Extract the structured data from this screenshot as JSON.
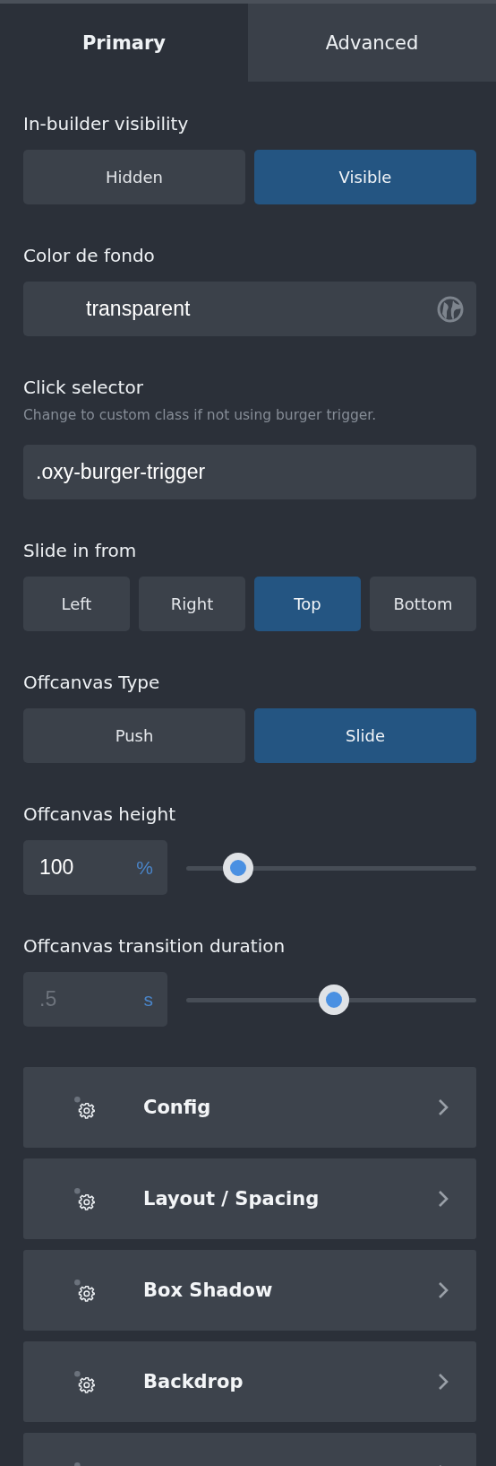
{
  "tabs": [
    {
      "label": "Primary",
      "selected": true
    },
    {
      "label": "Advanced",
      "selected": false
    }
  ],
  "controls": [
    {
      "kind": "toggle",
      "label": "In-builder visibility",
      "options": [
        {
          "label": "Hidden",
          "selected": false
        },
        {
          "label": "Visible",
          "selected": true
        }
      ]
    },
    {
      "kind": "color",
      "label": "Color de fondo",
      "value": "transparent"
    },
    {
      "kind": "text",
      "label": "Click selector",
      "hint": "Change to custom class if not using burger trigger.",
      "value": ".oxy-burger-trigger"
    },
    {
      "kind": "toggle",
      "label": "Slide in from",
      "options": [
        {
          "label": "Left",
          "selected": false
        },
        {
          "label": "Right",
          "selected": false
        },
        {
          "label": "Top",
          "selected": true
        },
        {
          "label": "Bottom",
          "selected": false
        }
      ]
    },
    {
      "kind": "toggle",
      "label": "Offcanvas Type",
      "options": [
        {
          "label": "Push",
          "selected": false
        },
        {
          "label": "Slide",
          "selected": true
        }
      ]
    },
    {
      "kind": "slider",
      "label": "Offcanvas height",
      "value": "100",
      "unit": "%",
      "level": 0.14
    },
    {
      "kind": "slider",
      "label": "Offcanvas transition duration",
      "placeholder": ".5",
      "unit": "s",
      "level": 0.51
    }
  ],
  "sections": [
    {
      "kind": "section",
      "label": "Config"
    },
    {
      "kind": "section",
      "label": "Layout / Spacing"
    },
    {
      "kind": "section",
      "label": "Box Shadow"
    },
    {
      "kind": "section",
      "label": "Backdrop"
    },
    {
      "kind": "cut"
    }
  ]
}
